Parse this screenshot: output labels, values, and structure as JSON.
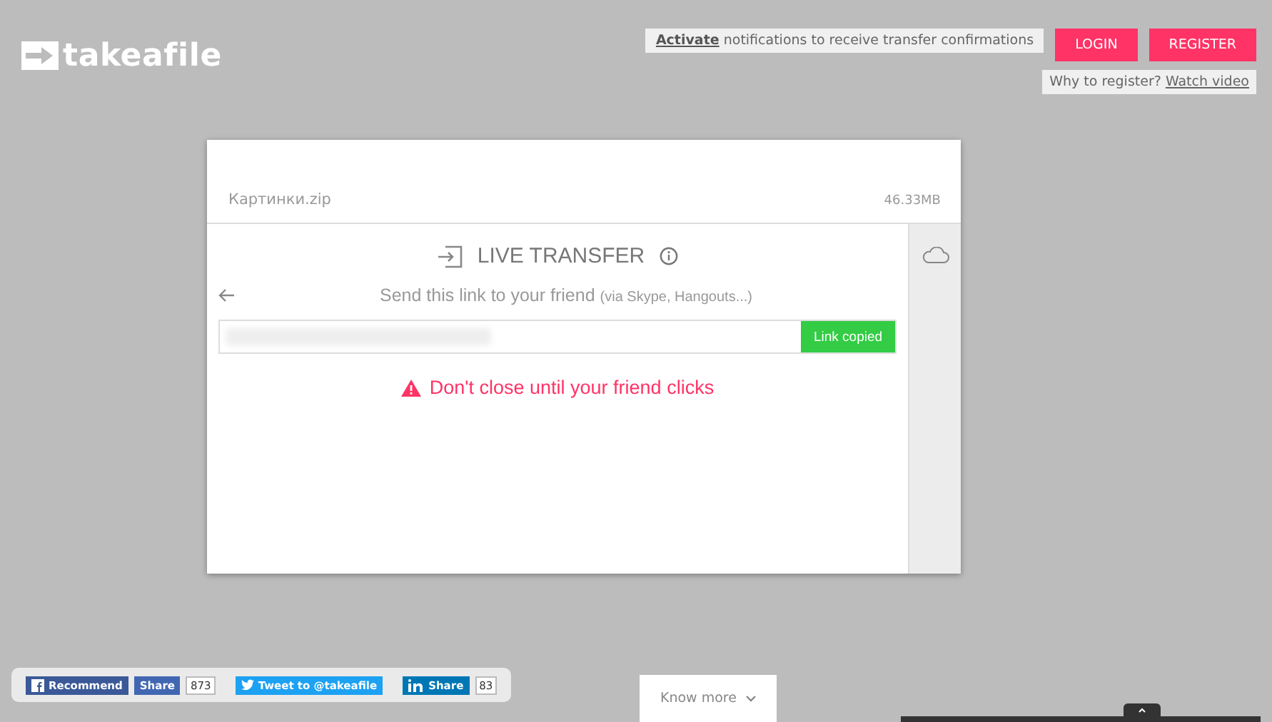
{
  "logo": {
    "text": "takeafile"
  },
  "notice": {
    "link": "Activate",
    "text": "notifications to receive transfer confirmations"
  },
  "header_buttons": [
    "LOGIN",
    "REGISTER"
  ],
  "register_hint": {
    "text": "Why to register?",
    "link": "Watch video"
  },
  "file": {
    "name": "Картинки.zip",
    "size": "46.33MB"
  },
  "transfer": {
    "title": "LIVE TRANSFER",
    "instruction": "Send this link to your friend",
    "instruction_note": "(via Skype, Hangouts...)",
    "copy_button": "Link copied",
    "warning": "Don't close until your friend clicks"
  },
  "social": [
    {
      "kind": "facebook",
      "label": "Recommend"
    },
    {
      "kind": "facebook-share",
      "label": "Share",
      "count": "873"
    },
    {
      "kind": "twitter",
      "label": "Tweet to @takeafile"
    },
    {
      "kind": "linkedin",
      "label": "Share",
      "count": "83"
    }
  ],
  "know_more": "Know more"
}
